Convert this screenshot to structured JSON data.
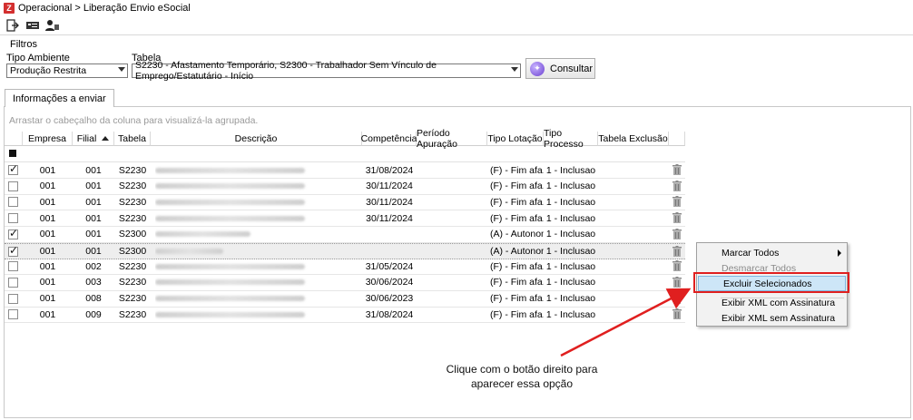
{
  "window": {
    "title": "Operacional > Liberação Envio eSocial",
    "app_icon_letter": "Z"
  },
  "filters": {
    "section_label": "Filtros",
    "ambiente_label": "Tipo Ambiente",
    "ambiente_value": "Produção Restrita",
    "tabela_label": "Tabela",
    "tabela_value": "S2230 - Afastamento Temporário, S2300 - Trabalhador Sem Vínculo de Emprego/Estatutário - Início",
    "consult_label": "Consultar"
  },
  "tabs": [
    {
      "label": "Informações a enviar"
    }
  ],
  "grid": {
    "group_hint": "Arrastar o cabeçalho da coluna para visualizá-la agrupada.",
    "columns": [
      "Empresa",
      "Filial",
      "Tabela",
      "Descrição",
      "Competência",
      "Período Apuração",
      "Tipo Lotação",
      "Tipo Processo",
      "Tabela Exclusão"
    ],
    "rows": [
      {
        "checked": true,
        "empresa": "001",
        "filial": "001",
        "tabela": "S2230",
        "competencia": "31/08/2024",
        "tipo_lotacao": "(F) - Fim afa...",
        "tipo_processo": "1 - Inclusao"
      },
      {
        "checked": false,
        "empresa": "001",
        "filial": "001",
        "tabela": "S2230",
        "competencia": "30/11/2024",
        "tipo_lotacao": "(F) - Fim afa...",
        "tipo_processo": "1 - Inclusao"
      },
      {
        "checked": false,
        "empresa": "001",
        "filial": "001",
        "tabela": "S2230",
        "competencia": "30/11/2024",
        "tipo_lotacao": "(F) - Fim afa...",
        "tipo_processo": "1 - Inclusao"
      },
      {
        "checked": false,
        "empresa": "001",
        "filial": "001",
        "tabela": "S2230",
        "competencia": "30/11/2024",
        "tipo_lotacao": "(F) - Fim afa...",
        "tipo_processo": "1 - Inclusao"
      },
      {
        "checked": true,
        "empresa": "001",
        "filial": "001",
        "tabela": "S2300",
        "competencia": "",
        "tipo_lotacao": "(A) - Autonomo",
        "tipo_processo": "1 - Inclusao"
      },
      {
        "checked": true,
        "empresa": "001",
        "filial": "001",
        "tabela": "S2300",
        "competencia": "",
        "tipo_lotacao": "(A) - Autonomo",
        "tipo_processo": "1 - Inclusao"
      },
      {
        "checked": false,
        "empresa": "001",
        "filial": "002",
        "tabela": "S2230",
        "competencia": "31/05/2024",
        "tipo_lotacao": "(F) - Fim afa...",
        "tipo_processo": "1 - Inclusao"
      },
      {
        "checked": false,
        "empresa": "001",
        "filial": "003",
        "tabela": "S2230",
        "competencia": "30/06/2024",
        "tipo_lotacao": "(F) - Fim afa...",
        "tipo_processo": "1 - Inclusao"
      },
      {
        "checked": false,
        "empresa": "001",
        "filial": "008",
        "tabela": "S2230",
        "competencia": "30/06/2023",
        "tipo_lotacao": "(F) - Fim afa...",
        "tipo_processo": "1 - Inclusao"
      },
      {
        "checked": false,
        "empresa": "001",
        "filial": "009",
        "tabela": "S2230",
        "competencia": "31/08/2024",
        "tipo_lotacao": "(F) - Fim afa...",
        "tipo_processo": "1 - Inclusao"
      }
    ]
  },
  "context_menu": {
    "items": [
      {
        "label": "Marcar Todos",
        "disabled": false,
        "submenu": true
      },
      {
        "label": "Desmarcar Todos",
        "disabled": true
      },
      {
        "label": "Excluir Selecionados",
        "selected": true
      },
      {
        "label": "Exibir XML com Assinatura"
      },
      {
        "label": "Exibir XML sem Assinatura"
      }
    ]
  },
  "annotation": {
    "line1": "Clique com o botão direito para",
    "line2": "aparecer essa opção",
    "color": "#e01f1f"
  }
}
